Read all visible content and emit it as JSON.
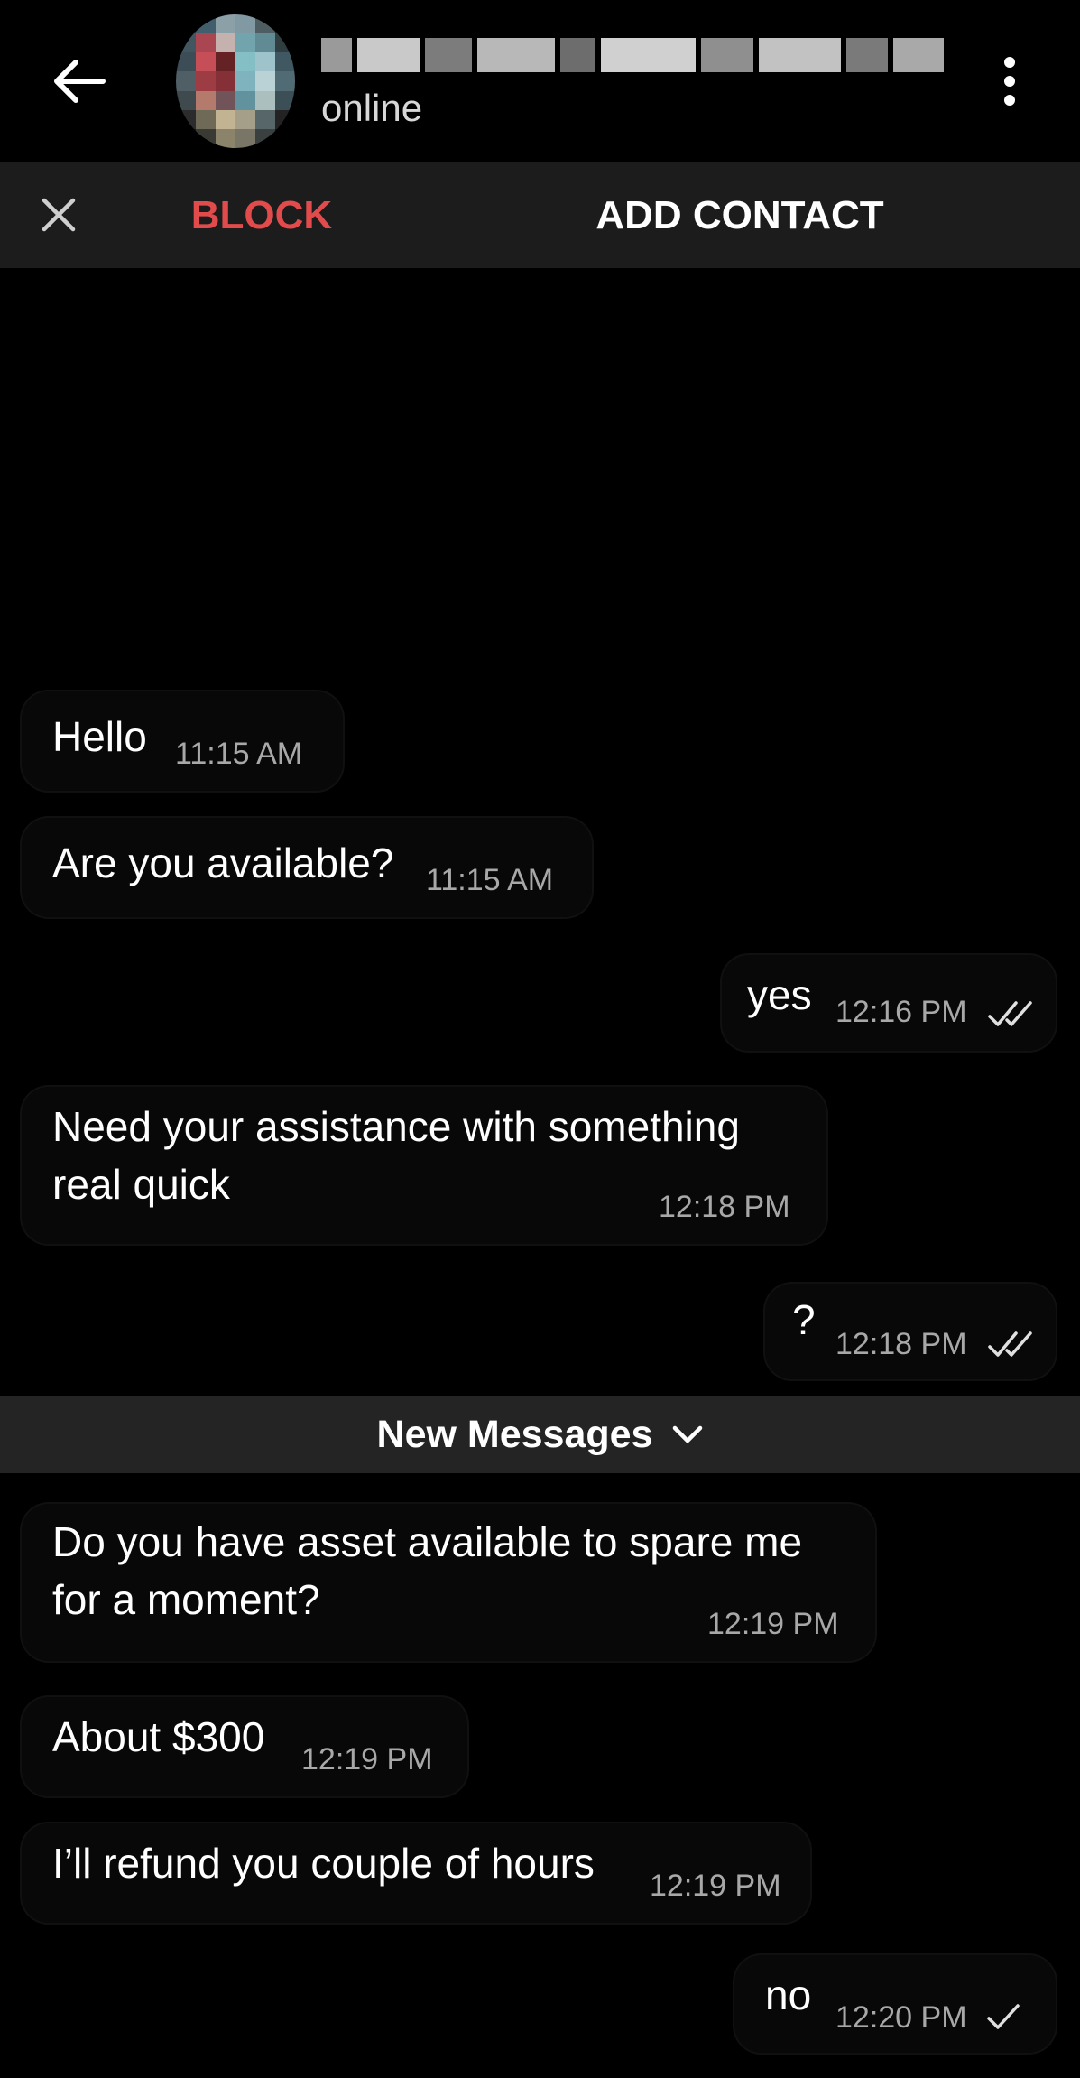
{
  "header": {
    "status": "online"
  },
  "action_bar": {
    "block_label": "BLOCK",
    "add_contact_label": "ADD CONTACT"
  },
  "messages": [
    {
      "text": "Hello",
      "time": "11:15 AM",
      "direction": "incoming"
    },
    {
      "text": "Are you available?",
      "time": "11:15 AM",
      "direction": "incoming"
    },
    {
      "text": "yes",
      "time": "12:16 PM",
      "direction": "outgoing",
      "status": "double-check-icon"
    },
    {
      "text": "Need your assistance with something",
      "text2": "real quick",
      "time": "12:18 PM",
      "direction": "incoming"
    },
    {
      "text": "?",
      "time": "12:18 PM",
      "direction": "outgoing",
      "status": "double-check-icon"
    },
    {
      "text": "Do you have asset available to spare me",
      "text2": "for a moment?",
      "time": "12:19 PM",
      "direction": "incoming"
    },
    {
      "text": "About $300",
      "time": "12:19 PM",
      "direction": "incoming"
    },
    {
      "text": "I’ll refund you couple of hours",
      "time": "12:19 PM",
      "direction": "incoming"
    },
    {
      "text": "no",
      "time": "12:20 PM",
      "direction": "outgoing",
      "status": "check-icon"
    }
  ],
  "new_messages_divider": {
    "label": "New Messages"
  },
  "colors": {
    "background": "#000000",
    "action_bar": "#1c1c1c",
    "block": "#e24b4b",
    "divider": "#242424",
    "time_text": "#a8a8a8"
  }
}
